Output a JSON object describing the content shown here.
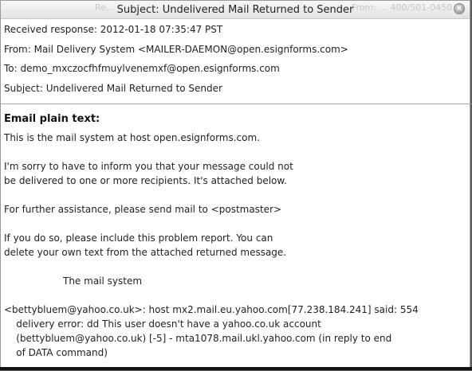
{
  "window": {
    "title": "Subject: Undelivered Mail Returned to Sender",
    "close_glyph": "×",
    "ghost_left": "Re...",
    "ghost_right": "From: ... 400/501-0450 ..."
  },
  "headers": {
    "received": "Received response: 2012-01-18 07:35:47 PST",
    "from": "From: Mail Delivery System <MAILER-DAEMON@open.esignforms.com>",
    "to": "To: demo_mxczocfhfmuylvenemxf@open.esignforms.com",
    "subject": "Subject: Undelivered Mail Returned to Sender"
  },
  "body": {
    "title": "Email plain text:",
    "p1": "This is the mail system at host open.esignforms.com.",
    "p2_l1": "I'm sorry to have to inform you that your message could not",
    "p2_l2": "be delivered to one or more recipients. It's attached below.",
    "p3": "For further assistance, please send mail to <postmaster>",
    "p4_l1": "If you do so, please include this problem report. You can",
    "p4_l2": "delete your own text from the attached returned message.",
    "signature": "The mail system",
    "p5_l1": "<bettybluem@yahoo.co.uk>: host mx2.mail.eu.yahoo.com[77.238.184.241] said: 554",
    "p5_l2": "    delivery error: dd This user doesn't have a yahoo.co.uk account",
    "p5_l3": "    (bettybluem@yahoo.co.uk) [-5] - mta1078.mail.ukl.yahoo.com (in reply to end",
    "p5_l4": "    of DATA command)"
  },
  "icons": {
    "close": "close-icon"
  }
}
